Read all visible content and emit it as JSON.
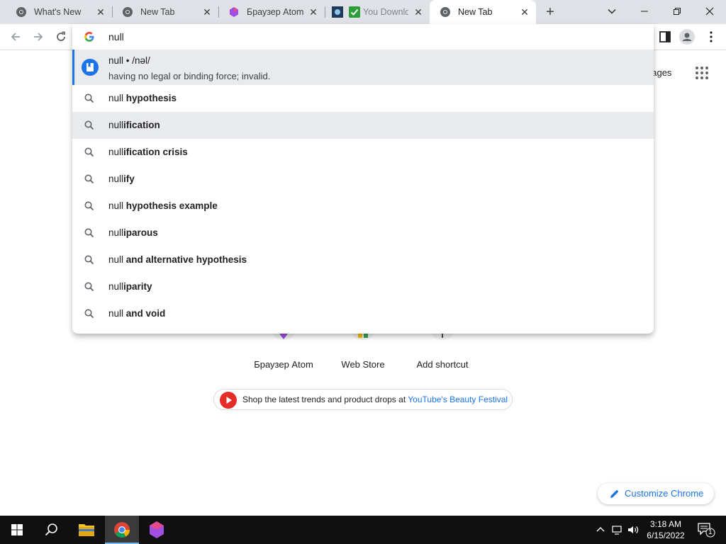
{
  "tabs": [
    {
      "title": "What's New",
      "icon": "chrome-icon"
    },
    {
      "title": "New Tab",
      "icon": "chrome-icon"
    },
    {
      "title": "Браузер Atom",
      "icon": "atom-icon"
    },
    {
      "title": "You Downlo",
      "icon": "download-check-icon"
    },
    {
      "title": "New Tab",
      "icon": "chrome-icon",
      "active": true
    }
  ],
  "tab_close_label": "✕",
  "new_tab_label": "+",
  "omnibox": {
    "value": "null",
    "definition": {
      "headline": "null • /nəl/",
      "meaning": "having no legal or binding force; invalid."
    },
    "suggestions": [
      {
        "prefix": "null ",
        "bold": "hypothesis"
      },
      {
        "prefix": "null",
        "bold": "ification",
        "highlighted": true
      },
      {
        "prefix": "null",
        "bold": "ification crisis"
      },
      {
        "prefix": "null",
        "bold": "ify"
      },
      {
        "prefix": "null ",
        "bold": "hypothesis example"
      },
      {
        "prefix": "null",
        "bold": "iparous"
      },
      {
        "prefix": "null ",
        "bold": "and alternative hypothesis"
      },
      {
        "prefix": "null",
        "bold": "iparity"
      },
      {
        "prefix": "null ",
        "bold": "and void"
      }
    ]
  },
  "page": {
    "images_link": "nages",
    "shortcuts": [
      {
        "label": "Браузер Atom"
      },
      {
        "label": "Web Store"
      },
      {
        "label": "Add shortcut"
      }
    ],
    "promo": {
      "text": "Shop the latest trends and product drops at ",
      "link": "YouTube's Beauty Festival"
    },
    "customize_label": "Customize Chrome"
  },
  "taskbar": {
    "time": "3:18 AM",
    "date": "6/15/2022",
    "notification_count": "1"
  },
  "colors": {
    "accent": "#1a73e8",
    "tabstrip": "#dee1e6",
    "taskbar": "#101010",
    "highlight": "#e8eaed"
  }
}
